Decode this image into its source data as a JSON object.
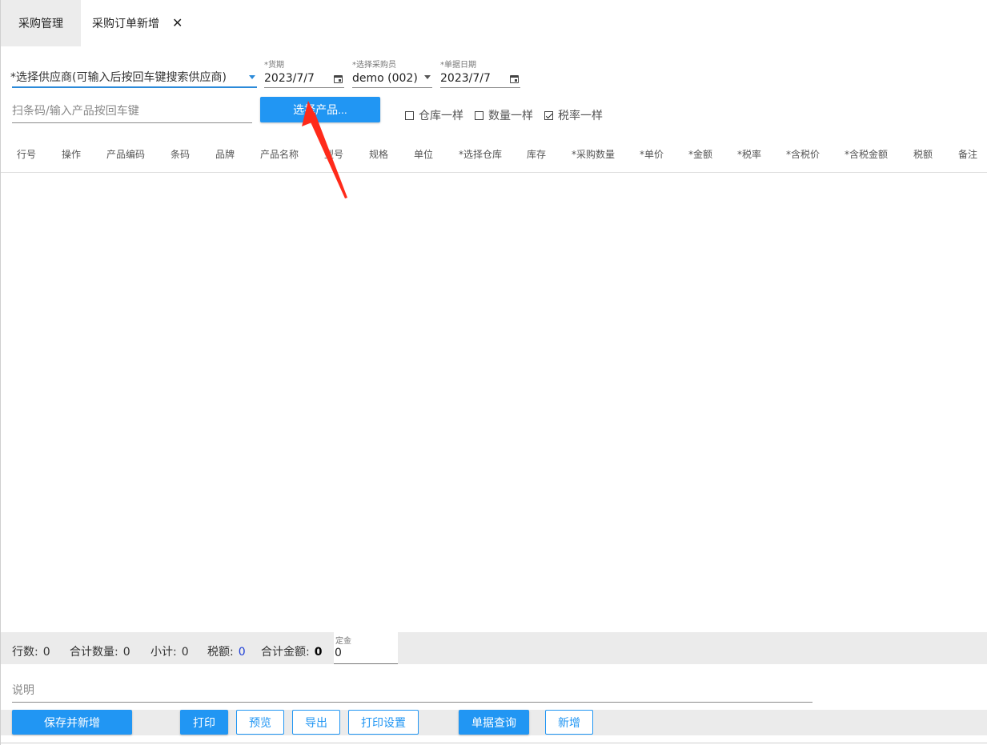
{
  "tabs": {
    "module": "采购管理",
    "active": "采购订单新增",
    "close": "✕"
  },
  "form": {
    "supplier": {
      "value": "*选择供应商(可输入后按回车键搜索供应商)"
    },
    "delivery_date": {
      "label": "*货期",
      "value": "2023/7/7"
    },
    "buyer": {
      "label": "*选择采购员",
      "value": "demo (002)"
    },
    "doc_date": {
      "label": "*单据日期",
      "value": "2023/7/7"
    },
    "scan": {
      "placeholder": "扫条码/输入产品按回车键"
    },
    "select_product_button": "选择产品...",
    "checkboxes": [
      {
        "label": "仓库一样",
        "checked": false
      },
      {
        "label": "数量一样",
        "checked": false
      },
      {
        "label": "税率一样",
        "checked": true
      }
    ]
  },
  "table": {
    "columns": [
      "行号",
      "操作",
      "产品编码",
      "条码",
      "品牌",
      "产品名称",
      "型号",
      "规格",
      "单位",
      "*选择仓库",
      "库存",
      "*采购数量",
      "*单价",
      "*金额",
      "*税率",
      "*含税价",
      "*含税金额",
      "税额",
      "备注"
    ],
    "rows": []
  },
  "summary": {
    "row_count_label": "行数:",
    "row_count": "0",
    "total_qty_label": "合计数量:",
    "total_qty": "0",
    "subtotal_label": "小计:",
    "subtotal": "0",
    "tax_label": "税额:",
    "tax": "0",
    "total_amount_label": "合计金额:",
    "total_amount": "0",
    "deposit_label": "定金",
    "deposit_value": "0"
  },
  "note": {
    "placeholder": "说明"
  },
  "toolbar": {
    "save_new": "保存并新增",
    "print": "打印",
    "preview": "预览",
    "export": "导出",
    "print_settings": "打印设置",
    "query": "单据查询",
    "new": "新增"
  },
  "colors": {
    "primary": "#2196f3",
    "arrow": "#ff2a1a",
    "tax_value": "#1e3fd6"
  }
}
